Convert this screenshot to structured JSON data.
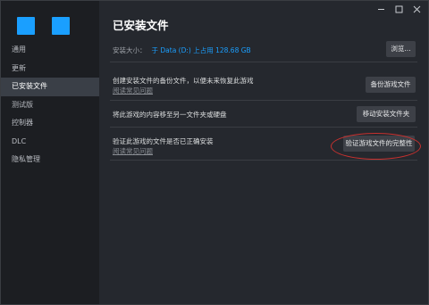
{
  "sidebar": {
    "items": [
      {
        "label": "通用"
      },
      {
        "label": "更新"
      },
      {
        "label": "已安装文件",
        "active": true
      },
      {
        "label": "测试版"
      },
      {
        "label": "控制器"
      },
      {
        "label": "DLC"
      },
      {
        "label": "隐私管理"
      }
    ],
    "logo_color": "#1a9fff"
  },
  "window": {
    "icons": [
      "minimize-icon",
      "maximize-icon",
      "close-icon"
    ]
  },
  "main": {
    "title": "已安装文件",
    "disk": {
      "label": "安装大小：",
      "value": "于 Data (D:) 上占用 128.68 GB",
      "browse_label": "浏览..."
    },
    "backup": {
      "text": "创建安装文件的备份文件，以便未来恢复此游戏",
      "link": "阅读常见问题",
      "button": "备份游戏文件"
    },
    "move": {
      "text": "将此游戏的内容移至另一文件夹或硬盘",
      "button": "移动安装文件夹"
    },
    "verify": {
      "text": "验证此游戏的文件是否已正确安装",
      "link": "阅读常见问题",
      "button": "验证游戏文件的完整性"
    }
  },
  "colors": {
    "accent": "#1a9fff",
    "annotation": "#c8312f",
    "sidebar_bg": "#1c1e22",
    "content_bg": "#25282e"
  }
}
